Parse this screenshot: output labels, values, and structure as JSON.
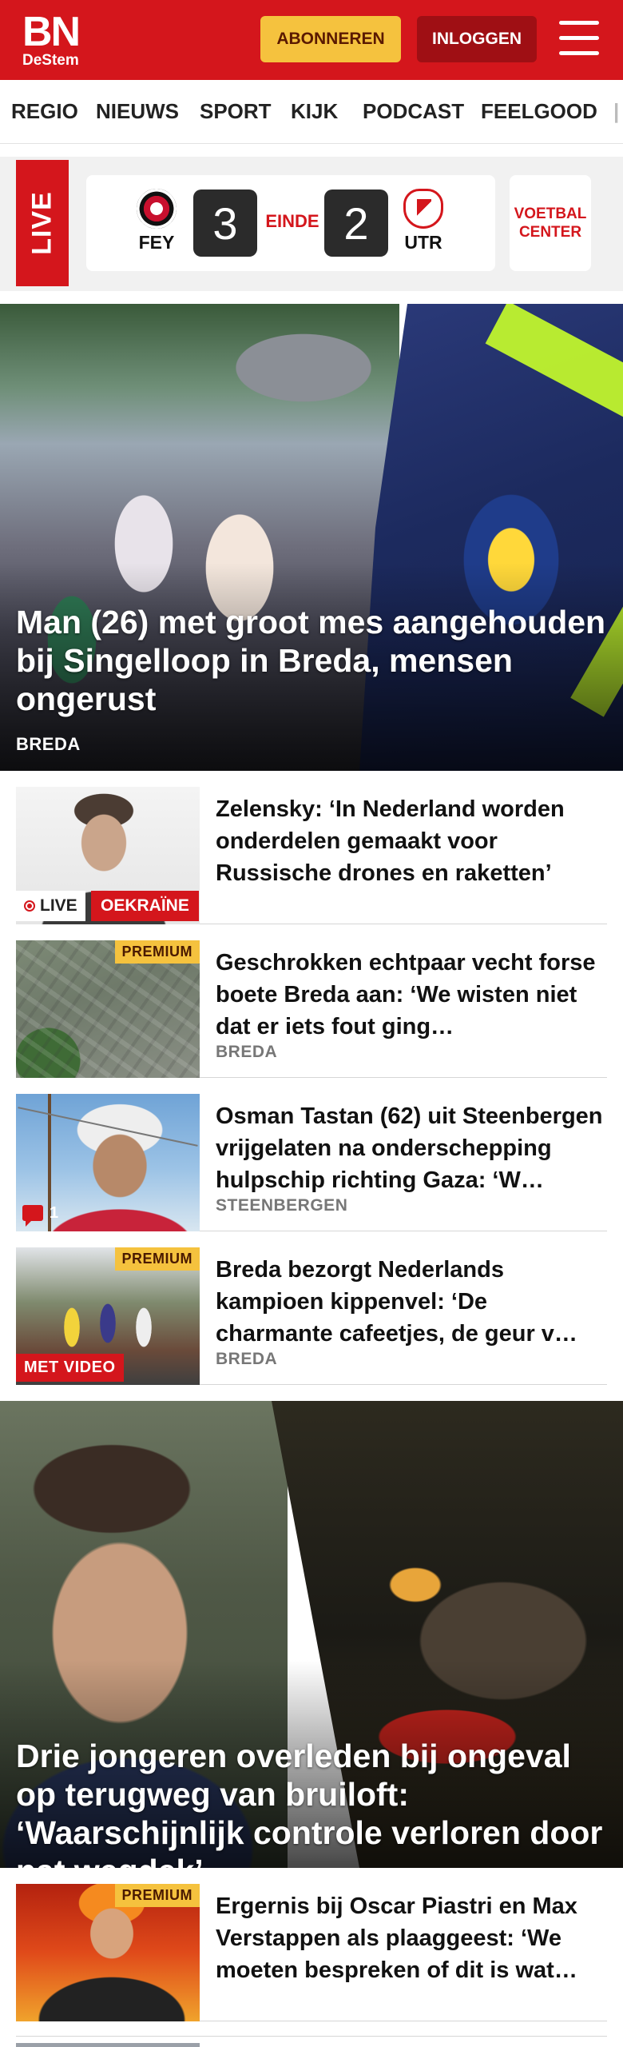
{
  "header": {
    "logo_main": "BN",
    "logo_sub": "DeStem",
    "subscribe_label": "ABONNEREN",
    "login_label": "INLOGGEN",
    "menu_icon": "hamburger-menu-icon"
  },
  "nav": {
    "items": [
      "REGIO",
      "NIEUWS",
      "SPORT",
      "KIJK",
      "PODCAST",
      "FEELGOOD"
    ]
  },
  "live_match": {
    "live_label": "LIVE",
    "home_team": "FEY",
    "away_team": "UTR",
    "home_score": "3",
    "away_score": "2",
    "status": "EINDE",
    "center_label": "VOETBAL CENTER"
  },
  "hero1": {
    "title": "Man (26) met groot mes aangehouden bij Singelloop in Breda, mensen ongerust",
    "tag": "BREDA"
  },
  "articles": [
    {
      "title": "Zelensky: ‘In Nederland worden onderdelen gemaakt voor Russische drones en raketten’",
      "live_label": "LIVE",
      "topic_label": "OEKRAÏNE"
    },
    {
      "title": "Geschrokken echtpaar vecht forse boete Breda aan: ‘We wisten niet dat er iets fout ging…",
      "place": "BREDA",
      "premium_label": "PREMIUM"
    },
    {
      "title": "Osman Tastan (62) uit Steenbergen vrijgelaten na onderschepping hulpschip richting Gaza: ‘W…",
      "place": "STEENBERGEN",
      "comment_count": "1"
    },
    {
      "title": "Breda bezorgt Nederlands kampioen kippenvel: ‘De charmante cafeetjes, de geur v…",
      "place": "BREDA",
      "premium_label": "PREMIUM",
      "video_label": "MET VIDEO"
    }
  ],
  "hero2": {
    "title": "Drie jongeren overleden bij ongeval op terugweg van bruiloft: ‘Waarschijnlijk controle verloren door nat wegdek’"
  },
  "article5": {
    "title": "Ergernis bij Oscar Piastri en Max Verstappen als plaaggeest: ‘We moeten bespreken of dit is wat…",
    "premium_label": "PREMIUM"
  },
  "colors": {
    "brand_red": "#d4161c",
    "premium_yellow": "#f5c23e",
    "login_dark_red": "#9f0f14"
  }
}
